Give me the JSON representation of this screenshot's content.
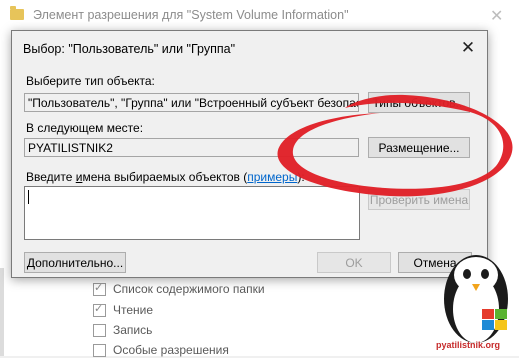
{
  "background_window": {
    "title": "Элемент разрешения для \"System Volume Information\"",
    "permissions": [
      {
        "label": "Список содержимого папки",
        "checked": true
      },
      {
        "label": "Чтение",
        "checked": true
      },
      {
        "label": "Запись",
        "checked": false
      },
      {
        "label": "Особые разрешения",
        "checked": false
      }
    ]
  },
  "dialog": {
    "title": "Выбор: \"Пользователь\" или \"Группа\"",
    "object_type_label": "Выберите тип объекта:",
    "object_type_value": "\"Пользователь\", \"Группа\" или \"Встроенный субъект безопасности\"",
    "object_types_button": "Типы объектов...",
    "location_label": "В следующем месте:",
    "location_value": "PYATILISTNIK2",
    "location_button": "Размещение...",
    "names_label_prefix": "Введите ",
    "names_label_underlined": "и",
    "names_label_rest": "мена выбираемых объектов (",
    "names_examples_link": "примеры",
    "names_label_suffix": "):",
    "names_value": "",
    "check_names_button": "Проверить имена",
    "advanced_button": "Дополнительно...",
    "ok_button": "OK",
    "cancel_button": "Отмена"
  },
  "logo": {
    "text": "pyatilistnik.org"
  },
  "colors": {
    "swoosh": "#e01f26",
    "link": "#0066cc",
    "ok_border": "#0078d7"
  }
}
